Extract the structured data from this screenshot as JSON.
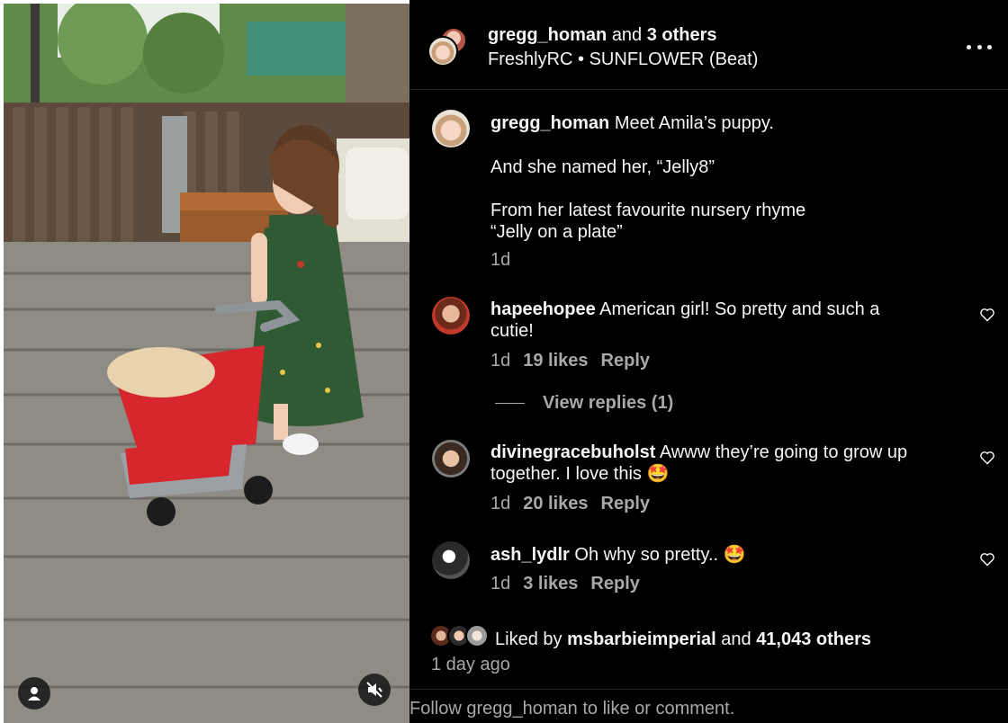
{
  "post": {
    "header": {
      "author": "gregg_homan",
      "and_text": "and",
      "coauthors": "3 others",
      "audio_artist": "FreshlyRC",
      "audio_separator": "•",
      "audio_track": "SUNFLOWER (Beat)"
    },
    "caption": {
      "username": "gregg_homan",
      "line1": "Meet Amila’s puppy.",
      "line2": "And she named her, “Jelly8”",
      "line3": "From her latest favourite nursery rhyme",
      "line4": "“Jelly on a plate”",
      "time": "1d"
    },
    "comments": [
      {
        "username": "hapeehopee",
        "text_line1": "American girl! So pretty and such a",
        "text_line2": "cutie!",
        "time": "1d",
        "likes": "19 likes",
        "reply": "Reply",
        "view_replies": "View replies (1)"
      },
      {
        "username": "divinegracebuholst",
        "text_line1": "Awww they’re going to grow up",
        "text_line2": "together. I love this 🤩",
        "time": "1d",
        "likes": "20 likes",
        "reply": "Reply"
      },
      {
        "username": "ash_lydlr",
        "text_line1": "Oh why so pretty.. 🤩",
        "time": "1d",
        "likes": "3 likes",
        "reply": "Reply"
      }
    ],
    "likes_summary": {
      "prefix": "Liked by",
      "user": "msbarbieimperial",
      "and_text": "and",
      "count": "41,043 others"
    },
    "posted_ago": "1 day ago",
    "footer_prompt": "Follow gregg_homan to like or comment."
  },
  "icons": {
    "more": "more-horizontal-icon",
    "heart": "heart-outline-icon",
    "user_tag": "user-tag-icon",
    "mute": "speaker-muted-icon"
  },
  "colors": {
    "panel_bg": "#000000",
    "primary_text": "#f5f5f5",
    "secondary_text": "#a8a8a8",
    "divider": "#262626"
  }
}
